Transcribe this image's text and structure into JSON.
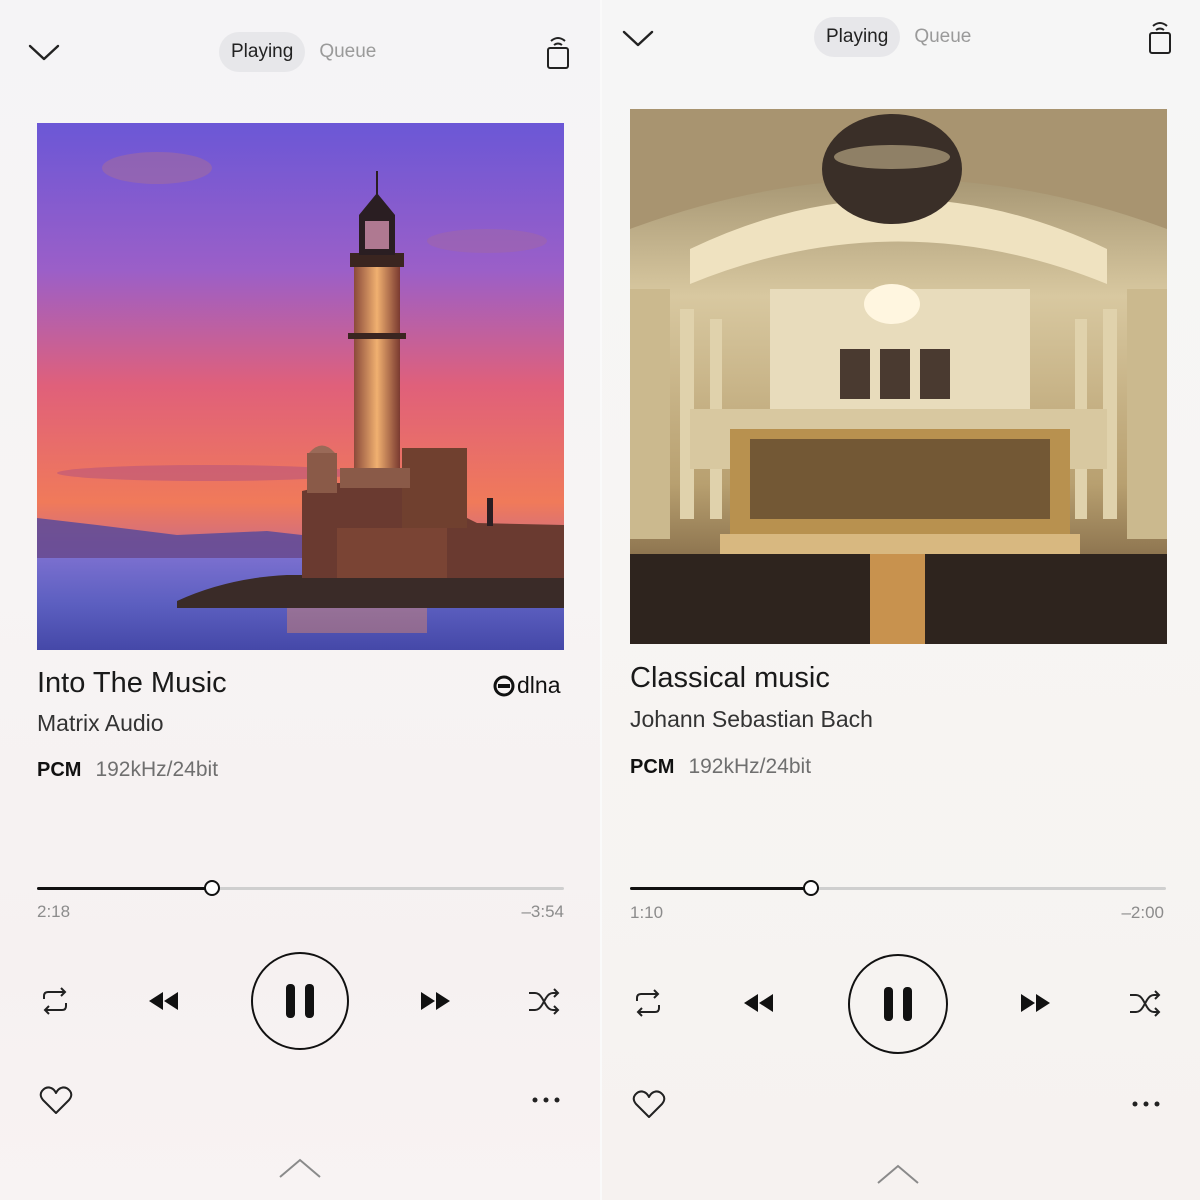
{
  "screens": [
    {
      "tabs": [
        {
          "label": "Playing",
          "active": true
        },
        {
          "label": "Queue",
          "active": false
        }
      ],
      "track": {
        "title": "Into The Music",
        "artist": "Matrix Audio",
        "format": "PCM",
        "quality": "192kHz/24bit",
        "source_badge": "dlna"
      },
      "progress": {
        "elapsed": "2:18",
        "remaining": "–3:54",
        "fraction": 0.333
      },
      "artwork": {
        "subject": "lighthouse at sunset"
      },
      "icons": [
        "chevron-down-icon",
        "remote-device-icon",
        "repeat-icon",
        "rewind-icon",
        "pause-icon",
        "fast-forward-icon",
        "shuffle-icon",
        "heart-icon",
        "more-icon",
        "chevron-up-icon"
      ]
    },
    {
      "tabs": [
        {
          "label": "Playing",
          "active": true
        },
        {
          "label": "Queue",
          "active": false
        }
      ],
      "track": {
        "title": "Classical music",
        "artist": "Johann Sebastian Bach",
        "format": "PCM",
        "quality": "192kHz/24bit"
      },
      "progress": {
        "elapsed": "1:10",
        "remaining": "–2:00",
        "fraction": 0.338
      },
      "artwork": {
        "subject": "concert hall with orchestra"
      },
      "icons": [
        "chevron-down-icon",
        "remote-device-icon",
        "repeat-icon",
        "rewind-icon",
        "pause-icon",
        "fast-forward-icon",
        "shuffle-icon",
        "heart-icon",
        "more-icon",
        "chevron-up-icon"
      ]
    }
  ],
  "colors": {
    "accent": "#111111",
    "track_inactive": "#cfcfcf",
    "tab_active_bg": "#e7e7ea",
    "muted_text": "#8c8c8c"
  }
}
